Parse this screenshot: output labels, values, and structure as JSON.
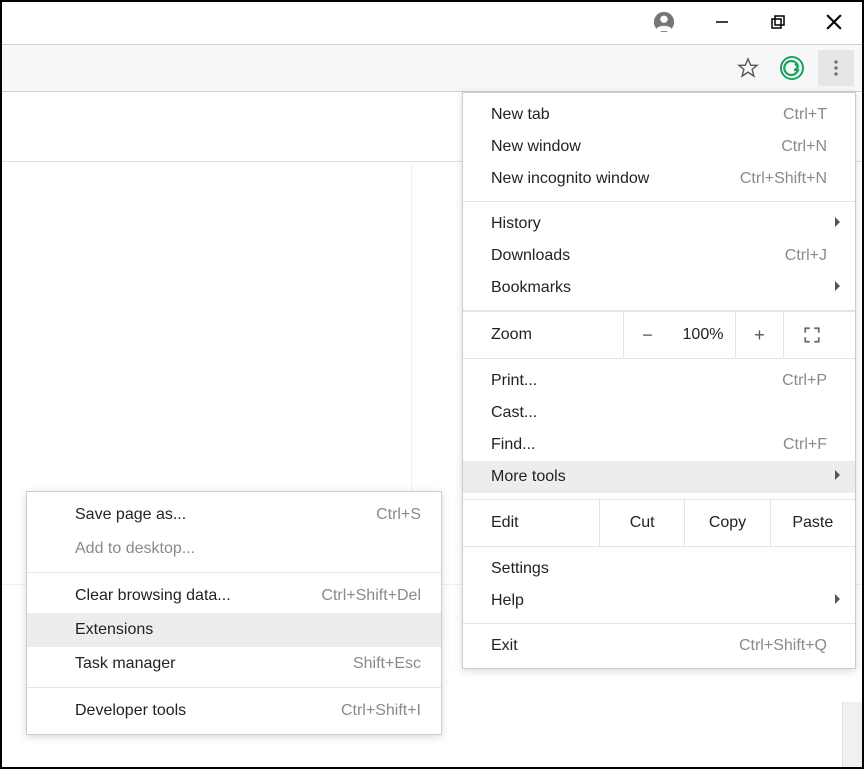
{
  "main_menu": {
    "sections": [
      {
        "items": [
          {
            "label": "New tab",
            "shortcut": "Ctrl+T",
            "name": "menu-new-tab"
          },
          {
            "label": "New window",
            "shortcut": "Ctrl+N",
            "name": "menu-new-window"
          },
          {
            "label": "New incognito window",
            "shortcut": "Ctrl+Shift+N",
            "name": "menu-new-incognito"
          }
        ]
      },
      {
        "items": [
          {
            "label": "History",
            "submenu": true,
            "name": "menu-history"
          },
          {
            "label": "Downloads",
            "shortcut": "Ctrl+J",
            "name": "menu-downloads"
          },
          {
            "label": "Bookmarks",
            "submenu": true,
            "name": "menu-bookmarks"
          }
        ]
      },
      {
        "zoom": {
          "label": "Zoom",
          "value": "100%"
        }
      },
      {
        "items": [
          {
            "label": "Print...",
            "shortcut": "Ctrl+P",
            "name": "menu-print"
          },
          {
            "label": "Cast...",
            "name": "menu-cast"
          },
          {
            "label": "Find...",
            "shortcut": "Ctrl+F",
            "name": "menu-find"
          },
          {
            "label": "More tools",
            "submenu": true,
            "highlight": true,
            "name": "menu-more-tools"
          }
        ]
      },
      {
        "edit": {
          "label": "Edit",
          "cut": "Cut",
          "copy": "Copy",
          "paste": "Paste"
        }
      },
      {
        "items": [
          {
            "label": "Settings",
            "name": "menu-settings"
          },
          {
            "label": "Help",
            "submenu": true,
            "name": "menu-help"
          }
        ]
      },
      {
        "items": [
          {
            "label": "Exit",
            "shortcut": "Ctrl+Shift+Q",
            "name": "menu-exit"
          }
        ]
      }
    ]
  },
  "sub_menu": {
    "sections": [
      {
        "items": [
          {
            "label": "Save page as...",
            "shortcut": "Ctrl+S",
            "name": "submenu-save-page"
          },
          {
            "label": "Add to desktop...",
            "disabled": true,
            "name": "submenu-add-desktop"
          }
        ]
      },
      {
        "items": [
          {
            "label": "Clear browsing data...",
            "shortcut": "Ctrl+Shift+Del",
            "name": "submenu-clear-data"
          },
          {
            "label": "Extensions",
            "highlight": true,
            "name": "submenu-extensions"
          },
          {
            "label": "Task manager",
            "shortcut": "Shift+Esc",
            "name": "submenu-task-manager"
          }
        ]
      },
      {
        "items": [
          {
            "label": "Developer tools",
            "shortcut": "Ctrl+Shift+I",
            "name": "submenu-dev-tools"
          }
        ]
      }
    ]
  }
}
